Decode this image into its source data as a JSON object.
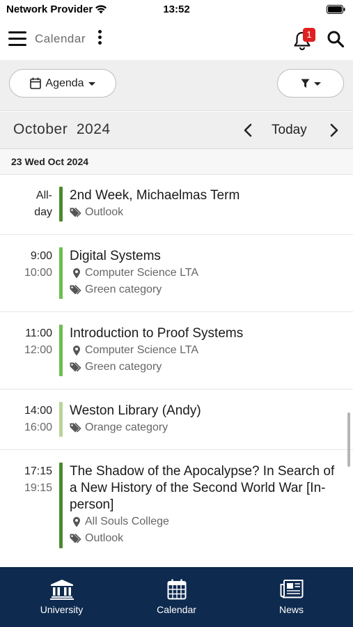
{
  "status_bar": {
    "carrier": "Network Provider",
    "time": "13:52"
  },
  "header": {
    "title": "Calendar",
    "notification_count": "1"
  },
  "toolbar": {
    "view_label": "Agenda"
  },
  "month_nav": {
    "month": "October",
    "year": "2024",
    "today_label": "Today"
  },
  "day": {
    "label": "23 Wed Oct 2024"
  },
  "events": [
    {
      "start": "All-",
      "end": "day",
      "title": "2nd Week, Michaelmas Term",
      "location": "",
      "category": "Outlook",
      "bar_color": "#4a8a2e"
    },
    {
      "start": "9:00",
      "end": "10:00",
      "title": "Digital Systems",
      "location": "Computer Science LTA",
      "category": "Green category",
      "bar_color": "#6cbf4f"
    },
    {
      "start": "11:00",
      "end": "12:00",
      "title": "Introduction to Proof Systems",
      "location": "Computer Science LTA",
      "category": "Green category",
      "bar_color": "#6cbf4f"
    },
    {
      "start": "14:00",
      "end": "16:00",
      "title": "Weston Library (Andy)",
      "location": "",
      "category": "Orange category",
      "bar_color": "#b8d49a"
    },
    {
      "start": "17:15",
      "end": "19:15",
      "title": "The Shadow of the Apocalypse? In Search of a New History of the Second World War [In-person]",
      "location": "All Souls College",
      "category": "Outlook",
      "bar_color": "#4a8a2e"
    }
  ],
  "bottom_nav": [
    {
      "label": "University",
      "icon": "university-icon"
    },
    {
      "label": "Calendar",
      "icon": "calendar-icon"
    },
    {
      "label": "News",
      "icon": "news-icon"
    }
  ],
  "colors": {
    "nav_bg": "#0e2a4e",
    "badge": "#e02020",
    "toolbar_bg": "#efefef"
  }
}
